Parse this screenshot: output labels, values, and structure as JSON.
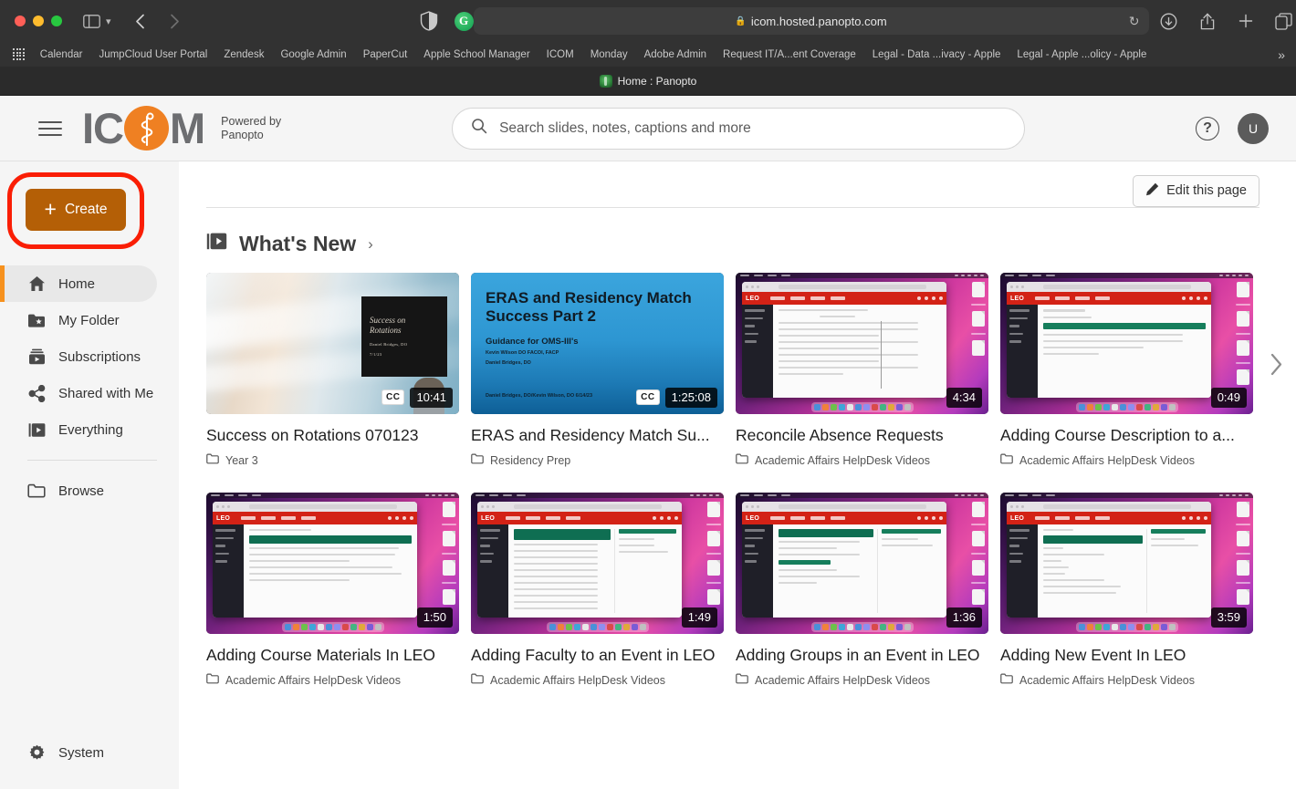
{
  "browser": {
    "url": "icom.hosted.panopto.com",
    "lock_icon": "lock-icon",
    "reload_icon": "reload-icon",
    "back_icon": "back-arrow-icon",
    "forward_icon": "forward-arrow-icon",
    "sidebar_icon": "sidebar-toggle-icon",
    "shield_icon": "privacy-shield-icon",
    "extension_icon": "grammarly-extension-icon",
    "download_icon": "download-icon",
    "share_icon": "share-icon",
    "new_tab_icon": "plus-icon",
    "tabs_overview_icon": "tab-overview-icon",
    "tab_title": "Home : Panopto",
    "bookmarks": [
      "Calendar",
      "JumpCloud User Portal",
      "Zendesk",
      "Google Admin",
      "PaperCut",
      "Apple School Manager",
      "ICOM",
      "Monday",
      "Adobe Admin",
      "Request IT/A...ent Coverage",
      "Legal - Data ...ivacy - Apple",
      "Legal - Apple ...olicy - Apple"
    ],
    "bookmarks_overflow": "»"
  },
  "header": {
    "menu_icon": "hamburger-menu-icon",
    "logo_text_left": "IC",
    "logo_text_right": "M",
    "powered_by_line1": "Powered by",
    "powered_by_line2": "Panopto",
    "search_placeholder": "Search slides, notes, captions and more",
    "search_value": "",
    "search_icon": "search-icon",
    "help_label": "?",
    "avatar_initial": "U"
  },
  "sidebar": {
    "create_label": "Create",
    "items": [
      {
        "label": "Home",
        "icon": "home-icon",
        "active": true
      },
      {
        "label": "My Folder",
        "icon": "folder-star-icon",
        "active": false
      },
      {
        "label": "Subscriptions",
        "icon": "subscriptions-icon",
        "active": false
      },
      {
        "label": "Shared with Me",
        "icon": "share-nodes-icon",
        "active": false
      },
      {
        "label": "Everything",
        "icon": "everything-icon",
        "active": false
      },
      {
        "label": "Browse",
        "icon": "folder-icon",
        "active": false
      }
    ],
    "system_label": "System",
    "system_icon": "gear-icon"
  },
  "main": {
    "edit_page_label": "Edit this page",
    "edit_page_icon": "pencil-icon",
    "section_title": "What's New",
    "section_icon": "video-library-icon",
    "section_chevron": "›",
    "carousel_next_icon": "chevron-right-icon",
    "row1": [
      {
        "title": "Success on Rotations 070123",
        "folder": "Year 3",
        "duration": "10:41",
        "cc": "CC",
        "has_cc": true,
        "slide_title_line1": "Success on",
        "slide_title_line2": "Rotations",
        "slide_presenter": "Daniel Bridges, DO",
        "slide_date": "7/1/23"
      },
      {
        "title": "ERAS and Residency Match Su...",
        "folder": "Residency Prep",
        "duration": "1:25:08",
        "cc": "CC",
        "has_cc": true,
        "slide_title_line1": "ERAS and Residency Match",
        "slide_title_line2": "Success Part 2",
        "slide_sub": "Guidance for OMS-III's",
        "slide_presenters_line1": "Kevin Wilson DO FACOI, FACP",
        "slide_presenters_line2": "Daniel Bridges, DO",
        "slide_footer": "Daniel Bridges, DO/Kevin Wilson, DO 6/14/23"
      },
      {
        "title": "Reconcile Absence Requests",
        "folder": "Academic Affairs HelpDesk Videos",
        "duration": "4:34",
        "has_cc": false
      },
      {
        "title": "Adding Course Description to a...",
        "folder": "Academic Affairs HelpDesk Videos",
        "duration": "0:49",
        "has_cc": false
      }
    ],
    "row2": [
      {
        "title": "Adding Course Materials In LEO",
        "folder": "Academic Affairs HelpDesk Videos",
        "duration": "1:50",
        "has_cc": false
      },
      {
        "title": "Adding Faculty to an Event in LEO",
        "folder": "Academic Affairs HelpDesk Videos",
        "duration": "1:49",
        "has_cc": false
      },
      {
        "title": "Adding Groups in an Event in LEO",
        "folder": "Academic Affairs HelpDesk Videos",
        "duration": "1:36",
        "has_cc": false
      },
      {
        "title": "Adding New Event In LEO",
        "folder": "Academic Affairs HelpDesk Videos",
        "duration": "3:59",
        "has_cc": false
      }
    ]
  },
  "colors": {
    "brand_orange": "#ef8022",
    "create_button": "#b45f06",
    "active_indicator": "#f6911e",
    "annotation_red": "#fa1e05",
    "logo_gray": "#6d6e71"
  }
}
